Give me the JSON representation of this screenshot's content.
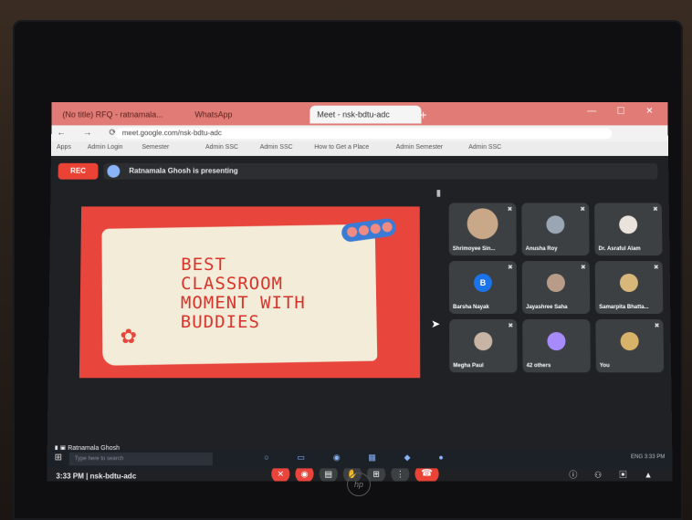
{
  "browser": {
    "tabs": [
      "(No title) RFQ - ratnamala...",
      "WhatsApp",
      "Meet - nsk-bdtu-adc"
    ],
    "url": "meet.google.com/nsk-bdtu-adc",
    "bookmarks": [
      "Apps",
      "Admin Login",
      "Semester",
      "Admin SSC",
      "Admin SSC",
      "How to Get a Place",
      "Admin Semester",
      "Admin SSC"
    ],
    "window_controls": "— ☐ ✕"
  },
  "meet": {
    "rec_label": "REC",
    "presenting_label": "Ratnamala Ghosh is presenting",
    "slide": {
      "lines": [
        "BEST",
        "CLASSROOM",
        "MOMENT WITH",
        "BUDDIES"
      ],
      "tag_color": "#3a7bd5",
      "bg_color": "#e8453c"
    },
    "participants": [
      {
        "name": "Shrimoyee Sin...",
        "avatar_color": "#c9a88a"
      },
      {
        "name": "Anusha Roy",
        "avatar_color": "#9aa6b4"
      },
      {
        "name": "Dr. Asraful Alam",
        "avatar_color": "#e9e3dc"
      },
      {
        "name": "Barsha Nayak",
        "avatar_color": "#1a73e8"
      },
      {
        "name": "Jayashree Saha",
        "avatar_color": "#b89c88"
      },
      {
        "name": "Samarpita Bhatta...",
        "avatar_color": "#d8b77a"
      },
      {
        "name": "Megha Paul",
        "avatar_color": "#c8b4a4"
      },
      {
        "name": "42 others",
        "avatar_color": "#a78bfa"
      },
      {
        "name": "You",
        "avatar_color": "#d7b36a"
      }
    ],
    "self_name": "Ratnamala Ghosh",
    "meeting_time": "3:33 PM | nsk-bdtu-adc",
    "control_icons": [
      "mic-off",
      "camera-off",
      "captions",
      "raise-hand",
      "present",
      "more"
    ],
    "end_call_icon": "phone-hangup"
  },
  "taskbar": {
    "search_placeholder": "Type here to search",
    "tray_text": "ENG 3:33 PM"
  },
  "device": {
    "brand_logo": "hp"
  }
}
